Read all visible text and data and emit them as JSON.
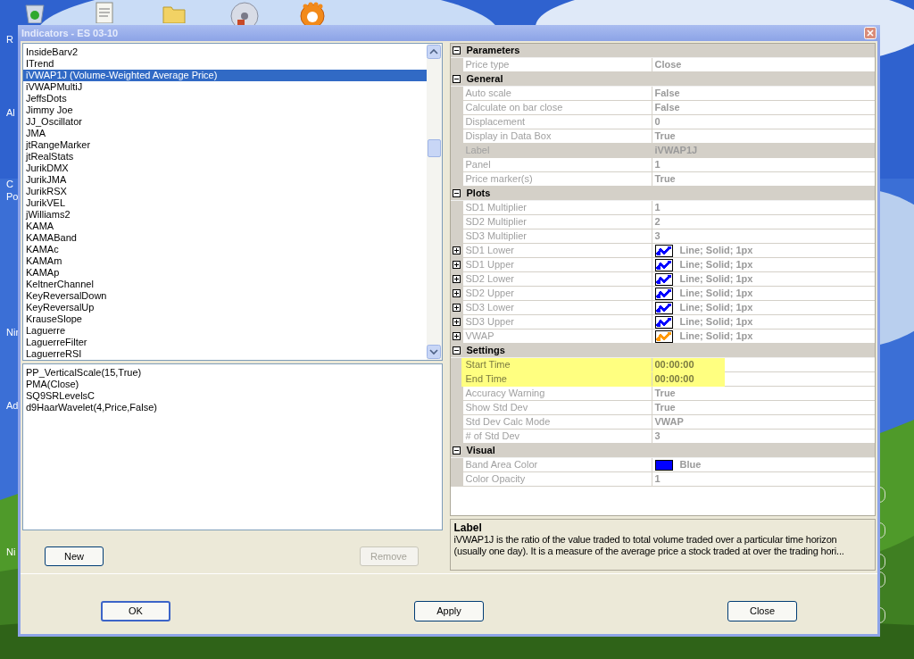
{
  "desktop": {
    "icon_labels": [
      {
        "text": "R",
        "kind": "top"
      },
      {
        "text": "Al",
        "kind": "mid"
      },
      {
        "text": "C",
        "kind": "mid"
      },
      {
        "text": "Po",
        "kind": "mid"
      },
      {
        "text": "Nir",
        "kind": "mid"
      },
      {
        "text": "Ad",
        "kind": "mid"
      },
      {
        "text": "Ni",
        "kind": "mid"
      }
    ]
  },
  "window": {
    "title": "Indicators - ES 03-10"
  },
  "indicator_list": [
    {
      "label": "InsideBarv2",
      "selected": false
    },
    {
      "label": "ITrend",
      "selected": false
    },
    {
      "label": "iVWAP1J (Volume-Weighted Average Price)",
      "selected": true
    },
    {
      "label": "iVWAPMultiJ",
      "selected": false
    },
    {
      "label": "JeffsDots",
      "selected": false
    },
    {
      "label": "Jimmy Joe",
      "selected": false
    },
    {
      "label": "JJ_Oscillator",
      "selected": false
    },
    {
      "label": "JMA",
      "selected": false
    },
    {
      "label": "jtRangeMarker",
      "selected": false
    },
    {
      "label": "jtRealStats",
      "selected": false
    },
    {
      "label": "JurikDMX",
      "selected": false
    },
    {
      "label": "JurikJMA",
      "selected": false
    },
    {
      "label": "JurikRSX",
      "selected": false
    },
    {
      "label": "JurikVEL",
      "selected": false
    },
    {
      "label": "jWilliams2",
      "selected": false
    },
    {
      "label": "KAMA",
      "selected": false
    },
    {
      "label": "KAMABand",
      "selected": false
    },
    {
      "label": "KAMAc",
      "selected": false
    },
    {
      "label": "KAMAm",
      "selected": false
    },
    {
      "label": "KAMAp",
      "selected": false
    },
    {
      "label": "KeltnerChannel",
      "selected": false
    },
    {
      "label": "KeyReversalDown",
      "selected": false
    },
    {
      "label": "KeyReversalUp",
      "selected": false
    },
    {
      "label": "KrauseSlope",
      "selected": false
    },
    {
      "label": "Laguerre",
      "selected": false
    },
    {
      "label": "LaguerreFilter",
      "selected": false
    },
    {
      "label": "LaguerreRSI",
      "selected": false
    }
  ],
  "applied_list": [
    "PP_VerticalScale(15,True)",
    "PMA(Close)",
    "SQ9SRLevelsC",
    "d9HaarWavelet(4,Price,False)"
  ],
  "list_buttons": [
    {
      "label": "New",
      "disabled": false
    },
    {
      "label": "Remove",
      "disabled": true
    }
  ],
  "property_grid": [
    {
      "category": "Parameters",
      "expanded": true,
      "properties": [
        {
          "name": "Price type",
          "value": "Close",
          "kind": "text",
          "expandable": false,
          "selected": false,
          "highlighted": false
        }
      ]
    },
    {
      "category": "General",
      "expanded": true,
      "properties": [
        {
          "name": "Auto scale",
          "value": "False",
          "kind": "text",
          "expandable": false,
          "selected": false,
          "highlighted": false
        },
        {
          "name": "Calculate on bar close",
          "value": "False",
          "kind": "text",
          "expandable": false,
          "selected": false,
          "highlighted": false
        },
        {
          "name": "Displacement",
          "value": "0",
          "kind": "text",
          "expandable": false,
          "selected": false,
          "highlighted": false
        },
        {
          "name": "Display in Data Box",
          "value": "True",
          "kind": "text",
          "expandable": false,
          "selected": false,
          "highlighted": false
        },
        {
          "name": "Label",
          "value": "iVWAP1J",
          "kind": "text",
          "expandable": false,
          "selected": true,
          "highlighted": false
        },
        {
          "name": "Panel",
          "value": "1",
          "kind": "text",
          "expandable": false,
          "selected": false,
          "highlighted": false
        },
        {
          "name": "Price marker(s)",
          "value": "True",
          "kind": "text",
          "expandable": false,
          "selected": false,
          "highlighted": false
        }
      ]
    },
    {
      "category": "Plots",
      "expanded": true,
      "properties": [
        {
          "name": "SD1 Multiplier",
          "value": "1",
          "kind": "text",
          "expandable": false,
          "selected": false,
          "highlighted": false
        },
        {
          "name": "SD2 Multiplier",
          "value": "2",
          "kind": "text",
          "expandable": false,
          "selected": false,
          "highlighted": false
        },
        {
          "name": "SD3 Multiplier",
          "value": "3",
          "kind": "text",
          "expandable": false,
          "selected": false,
          "highlighted": false
        },
        {
          "name": "SD1 Lower",
          "value": "Line; Solid; 1px",
          "kind": "plot",
          "color": "#0000ff",
          "expandable": true,
          "selected": false,
          "highlighted": false
        },
        {
          "name": "SD1 Upper",
          "value": "Line; Solid; 1px",
          "kind": "plot",
          "color": "#0000ff",
          "expandable": true,
          "selected": false,
          "highlighted": false
        },
        {
          "name": "SD2 Lower",
          "value": "Line; Solid; 1px",
          "kind": "plot",
          "color": "#0000ff",
          "expandable": true,
          "selected": false,
          "highlighted": false
        },
        {
          "name": "SD2 Upper",
          "value": "Line; Solid; 1px",
          "kind": "plot",
          "color": "#0000ff",
          "expandable": true,
          "selected": false,
          "highlighted": false
        },
        {
          "name": "SD3 Lower",
          "value": "Line; Solid; 1px",
          "kind": "plot",
          "color": "#0000ff",
          "expandable": true,
          "selected": false,
          "highlighted": false
        },
        {
          "name": "SD3 Upper",
          "value": "Line; Solid; 1px",
          "kind": "plot",
          "color": "#0000ff",
          "expandable": true,
          "selected": false,
          "highlighted": false
        },
        {
          "name": "VWAP",
          "value": "Line; Solid; 1px",
          "kind": "plot",
          "color": "#ff9900",
          "expandable": true,
          "selected": false,
          "highlighted": false
        }
      ]
    },
    {
      "category": "Settings",
      "expanded": true,
      "properties": [
        {
          "name": "Start Time",
          "value": "00:00:00",
          "kind": "text",
          "expandable": false,
          "selected": false,
          "highlighted": true
        },
        {
          "name": "End Time",
          "value": "00:00:00",
          "kind": "text",
          "expandable": false,
          "selected": false,
          "highlighted": true
        },
        {
          "name": "Accuracy Warning",
          "value": "True",
          "kind": "text",
          "expandable": false,
          "selected": false,
          "highlighted": false
        },
        {
          "name": "Show Std Dev",
          "value": "True",
          "kind": "text",
          "expandable": false,
          "selected": false,
          "highlighted": false
        },
        {
          "name": "Std Dev Calc Mode",
          "value": "VWAP",
          "kind": "text",
          "expandable": false,
          "selected": false,
          "highlighted": false
        },
        {
          "name": "# of Std Dev",
          "value": "3",
          "kind": "text",
          "expandable": false,
          "selected": false,
          "highlighted": false
        }
      ]
    },
    {
      "category": "Visual",
      "expanded": true,
      "properties": [
        {
          "name": "Band Area Color",
          "value": "Blue",
          "kind": "color",
          "color": "#0000ff",
          "expandable": false,
          "selected": false,
          "highlighted": false
        },
        {
          "name": "Color Opacity",
          "value": "1",
          "kind": "text",
          "expandable": false,
          "selected": false,
          "highlighted": false
        }
      ]
    }
  ],
  "description": {
    "title": "Label",
    "text": "iVWAP1J is the ratio of the value traded to total volume traded over a particular time horizon (usually one day). It is a measure of the average price a stock traded at over the trading hori..."
  },
  "dialog_buttons": [
    {
      "label": "OK",
      "default": true
    },
    {
      "label": "Apply",
      "default": false
    },
    {
      "label": "Close",
      "default": false
    }
  ]
}
